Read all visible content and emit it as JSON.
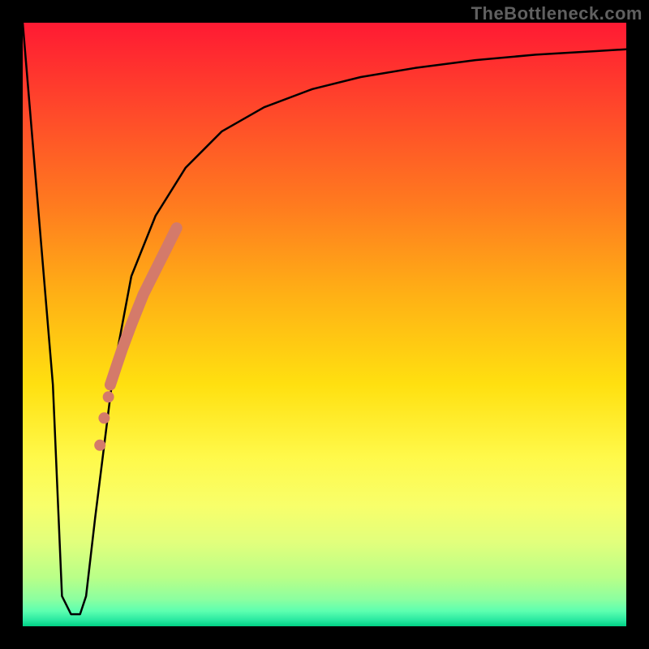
{
  "watermark": "TheBottleneck.com",
  "chart_data": {
    "type": "line",
    "title": "",
    "xlabel": "",
    "ylabel": "",
    "xlim": [
      0,
      100
    ],
    "ylim": [
      0,
      100
    ],
    "grid": false,
    "legend": false,
    "series": [
      {
        "name": "bottleneck-curve",
        "x": [
          0,
          5,
          6.5,
          8,
          9.5,
          10.5,
          12,
          15,
          18,
          22,
          27,
          33,
          40,
          48,
          56,
          65,
          75,
          85,
          95,
          100
        ],
        "y": [
          100,
          40,
          5,
          2,
          2,
          5,
          18,
          42,
          58,
          68,
          76,
          82,
          86,
          89,
          91,
          92.5,
          93.8,
          94.7,
          95.3,
          95.6
        ],
        "color": "#000000"
      }
    ],
    "highlight_segment": {
      "name": "highlighted-range",
      "x": [
        14.5,
        15.5,
        16.5,
        18,
        20,
        22,
        24,
        25.5
      ],
      "y": [
        40,
        43,
        46,
        50,
        55,
        59,
        63,
        66
      ],
      "color": "#d47a6a"
    },
    "highlight_dots": {
      "name": "highlighted-dots",
      "points": [
        {
          "x": 14.2,
          "y": 38
        },
        {
          "x": 13.5,
          "y": 34.5
        },
        {
          "x": 12.8,
          "y": 30
        }
      ],
      "color": "#d47a6a"
    },
    "gradient_colors": {
      "top": "#ff1a33",
      "mid": "#ffe010",
      "bottom": "#00d084"
    }
  }
}
